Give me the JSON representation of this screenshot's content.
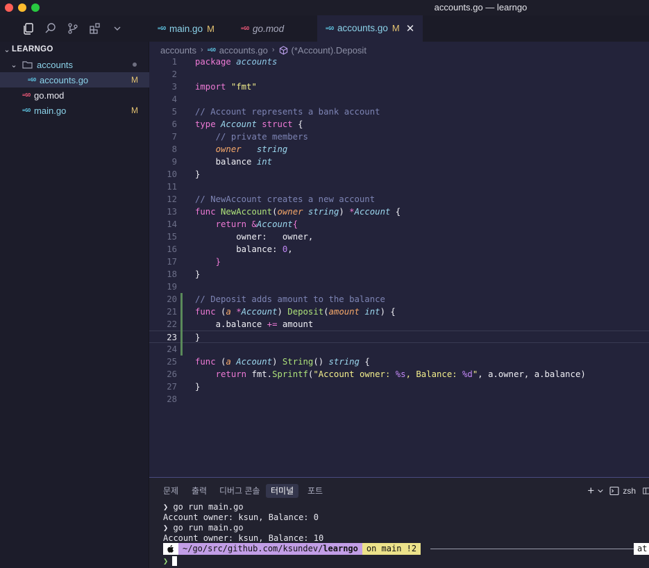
{
  "window": {
    "title": "accounts.go — learngo"
  },
  "activity": {
    "icons": [
      "explorer-icon",
      "search-icon",
      "source-control-icon",
      "extensions-icon",
      "chevron-down-icon"
    ]
  },
  "tabs": [
    {
      "badge": "=GO",
      "label": "main.go",
      "modified": "M",
      "italic": false,
      "active": false
    },
    {
      "badge": "=GO",
      "label": "go.mod",
      "modified": "",
      "italic": true,
      "active": false
    },
    {
      "badge": "=GO",
      "label": "accounts.go",
      "modified": "M",
      "italic": false,
      "active": true,
      "close": "✕"
    }
  ],
  "sidebar": {
    "root": "LEARNGO",
    "items": [
      {
        "label": "accounts",
        "type": "folder"
      },
      {
        "label": "accounts.go",
        "badge": "=GO",
        "status": "M"
      },
      {
        "label": "go.mod",
        "badge": "=GO",
        "status": ""
      },
      {
        "label": "main.go",
        "badge": "=GO",
        "status": "M"
      }
    ]
  },
  "breadcrumb": {
    "folder": "accounts",
    "file_badge": "=GO",
    "file": "accounts.go",
    "symbol": "(*Account).Deposit"
  },
  "editor": {
    "current_line": 23,
    "lines": [
      "package accounts",
      "",
      "import \"fmt\"",
      "",
      "// Account represents a bank account",
      "type Account struct {",
      "    // private members",
      "    owner   string",
      "    balance int",
      "}",
      "",
      "// NewAccount creates a new account",
      "func NewAccount(owner string) *Account {",
      "    return &Account{",
      "        owner:   owner,",
      "        balance: 0,",
      "    }",
      "}",
      "",
      "// Deposit adds amount to the balance",
      "func (a *Account) Deposit(amount int) {",
      "    a.balance += amount",
      "}",
      "",
      "func (a Account) String() string {",
      "    return fmt.Sprintf(\"Account owner: %s, Balance: %d\", a.owner, a.balance)",
      "}",
      ""
    ]
  },
  "panel": {
    "tabs": [
      "문제",
      "출력",
      "디버그 콘솔",
      "터미널",
      "포트"
    ],
    "active_tab": "터미널",
    "shell": "zsh",
    "add_label": "+",
    "terminal_lines": [
      {
        "prompt": "❯",
        "text": "go run main.go"
      },
      {
        "prompt": "",
        "text": "Account owner: ksun, Balance: 0"
      },
      {
        "prompt": "❯",
        "text": "go run main.go"
      },
      {
        "prompt": "",
        "text": "Account owner: ksun, Balance: 10"
      }
    ],
    "prompt_bar": {
      "path_prefix": "~/go/src/github.com/ksundev/",
      "path_bold": "learngo",
      "git": "on  main !2",
      "right": "at"
    },
    "input_prompt": "❯"
  }
}
